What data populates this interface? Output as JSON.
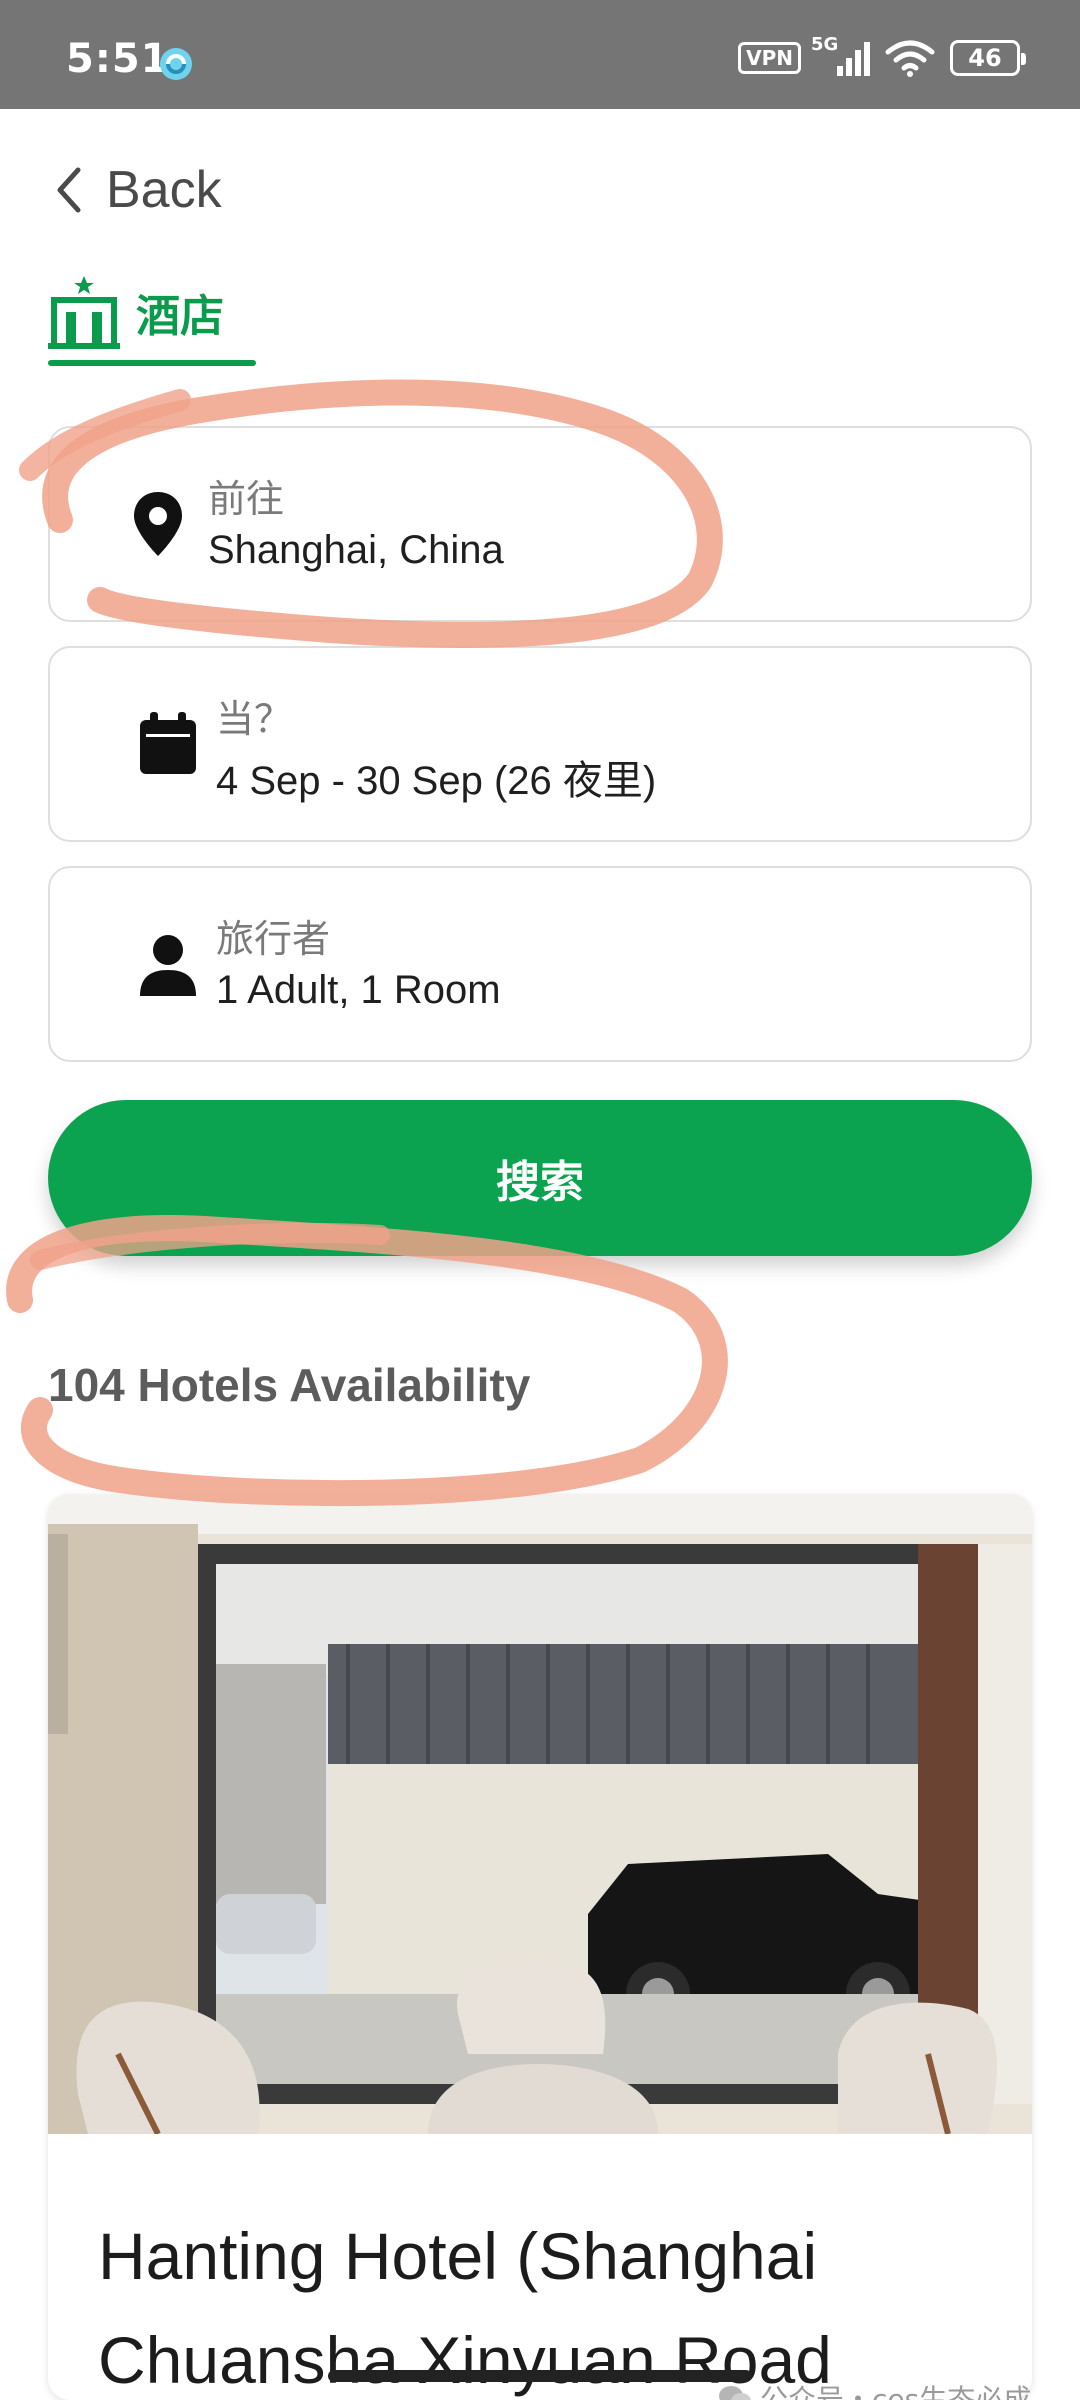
{
  "status_bar": {
    "time": "5:51",
    "vpn": "VPN",
    "network": "5G",
    "battery": "46"
  },
  "header": {
    "back_label": "Back"
  },
  "tab": {
    "label": "酒店"
  },
  "destination": {
    "label": "前往",
    "value": "Shanghai, China"
  },
  "dates": {
    "label": "当？",
    "value": "4 Sep - 30 Sep (26 夜里)"
  },
  "travelers": {
    "label": "旅行者",
    "value": "1 Adult, 1 Room"
  },
  "search_button": {
    "label": "搜索"
  },
  "results": {
    "availability": "104 Hotels Availability"
  },
  "hotel_card": {
    "name": "Hanting Hotel (Shanghai Chuansha Xinyuan Road"
  },
  "watermark": {
    "text": "公众号・ces生态必成"
  },
  "colors": {
    "accent": "#0ba350",
    "status_bar": "#757575",
    "scribble": "#f0a28a"
  },
  "icons": {
    "back": "chevron-left-icon",
    "tab": "hotel-building-icon",
    "destination": "location-pin-icon",
    "dates": "calendar-icon",
    "travelers": "person-icon"
  }
}
